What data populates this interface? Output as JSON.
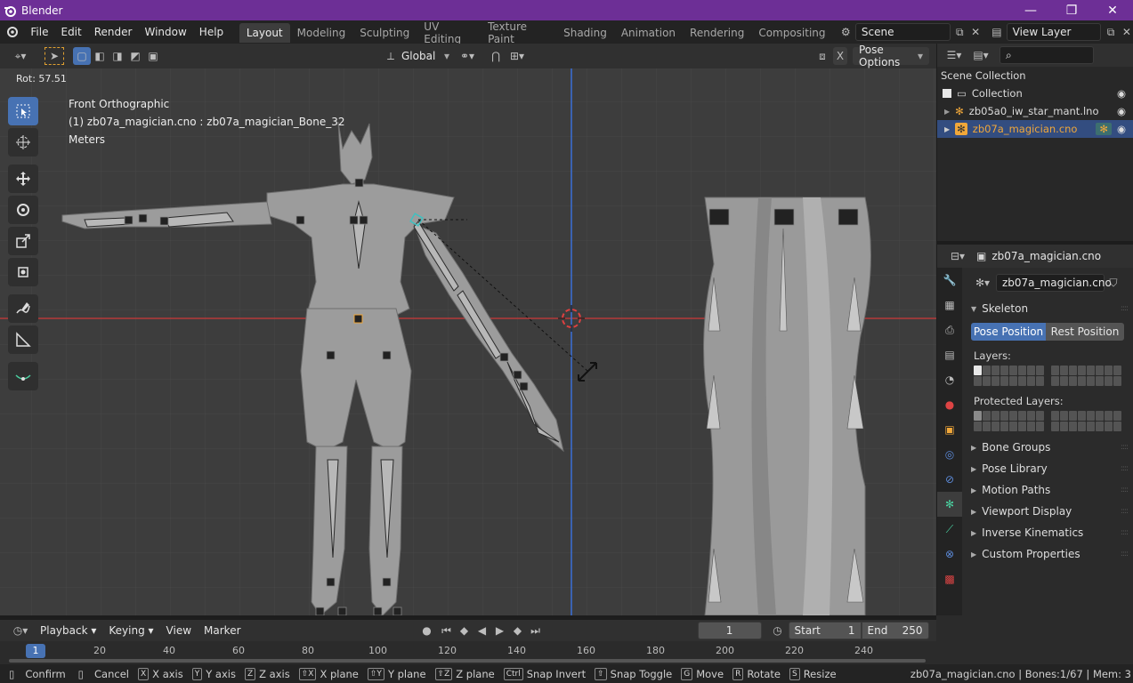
{
  "window": {
    "title": "Blender"
  },
  "menus": [
    "File",
    "Edit",
    "Render",
    "Window",
    "Help"
  ],
  "workspaces": [
    "Layout",
    "Modeling",
    "Sculpting",
    "UV Editing",
    "Texture Paint",
    "Shading",
    "Animation",
    "Rendering",
    "Compositing"
  ],
  "scene": {
    "name": "Scene",
    "view_layer": "View Layer"
  },
  "viewport_header": {
    "orientation": "Global",
    "pose_options": "Pose Options",
    "x_mirror": "X"
  },
  "viewport": {
    "rot_readout": "Rot: 57.51",
    "view_name": "Front Orthographic",
    "active_info": "(1) zb07a_magician.cno : zb07a_magician_Bone_32",
    "units": "Meters"
  },
  "outliner": {
    "title": "Scene Collection",
    "collection": "Collection",
    "items": [
      "zb05a0_iw_star_mant.lno",
      "zb07a_magician.cno"
    ]
  },
  "properties": {
    "object_name": "zb07a_magician.cno",
    "armature_name": "zb07a_magician.cno",
    "skeleton_label": "Skeleton",
    "pose_position": "Pose Position",
    "rest_position": "Rest Position",
    "layers_label": "Layers:",
    "protected_label": "Protected Layers:",
    "panels": [
      "Bone Groups",
      "Pose Library",
      "Motion Paths",
      "Viewport Display",
      "Inverse Kinematics",
      "Custom Properties"
    ]
  },
  "timeline": {
    "menus": [
      "Playback",
      "Keying",
      "View",
      "Marker"
    ],
    "current_frame": "1",
    "start_label": "Start",
    "start": "1",
    "end_label": "End",
    "end": "250",
    "ruler": [
      "1",
      "20",
      "40",
      "60",
      "80",
      "100",
      "120",
      "140",
      "160",
      "180",
      "200",
      "220",
      "240"
    ]
  },
  "statusbar": {
    "items": [
      {
        "key": "",
        "label": "Confirm"
      },
      {
        "key": "",
        "label": "Cancel"
      },
      {
        "key": "X",
        "label": "X axis"
      },
      {
        "key": "Y",
        "label": "Y axis"
      },
      {
        "key": "Z",
        "label": "Z axis"
      },
      {
        "key": "⇧X",
        "label": "X plane"
      },
      {
        "key": "⇧Y",
        "label": "Y plane"
      },
      {
        "key": "⇧Z",
        "label": "Z plane"
      },
      {
        "key": "Ctrl",
        "label": "Snap Invert"
      },
      {
        "key": "⇧",
        "label": "Snap Toggle"
      },
      {
        "key": "G",
        "label": "Move"
      },
      {
        "key": "R",
        "label": "Rotate"
      },
      {
        "key": "S",
        "label": "Resize"
      }
    ],
    "info": "zb07a_magician.cno | Bones:1/67 | Mem: 3"
  },
  "colors": {
    "title_bar": "#6d2f96",
    "accent": "#4772b3",
    "selected_text": "#f0a73a",
    "x_axis": "#b33a3a",
    "z_axis": "#3a6fd8"
  }
}
